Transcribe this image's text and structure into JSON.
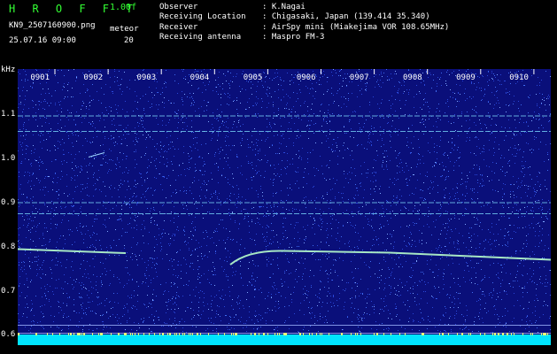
{
  "header": {
    "logo": "H R O F F T",
    "version": "1.00f",
    "filename": "KN9_2507160900.png",
    "meteor_label": "meteor",
    "timestamp": "25.07.16 09:00",
    "meteor_count": "20",
    "info": [
      {
        "label": "Observer",
        "value": ": K.Nagai"
      },
      {
        "label": "Receiving Location",
        "value": ": Chigasaki, Japan (139.414 35.340)"
      },
      {
        "label": "Receiver",
        "value": ": AirSpy mini (Miakejima VOR 108.65MHz)"
      },
      {
        "label": "Receiving antenna",
        "value": ": Maspro FM-3"
      }
    ]
  },
  "axis": {
    "y_unit": "kHz",
    "y_ticks": [
      "1.1",
      "1.0",
      "0.9",
      "0.8",
      "0.7",
      "0.6"
    ],
    "x_ticks": [
      "0901",
      "0902",
      "0903",
      "0904",
      "0905",
      "0906",
      "0907",
      "0908",
      "0909",
      "0910"
    ]
  },
  "colors": {
    "background": "#000000",
    "plot_base": "#0a0f7a",
    "noise": "#2a47d8",
    "signal": "#b8ffcc",
    "band": "#00e5ff",
    "text_green": "#33ff33"
  }
}
